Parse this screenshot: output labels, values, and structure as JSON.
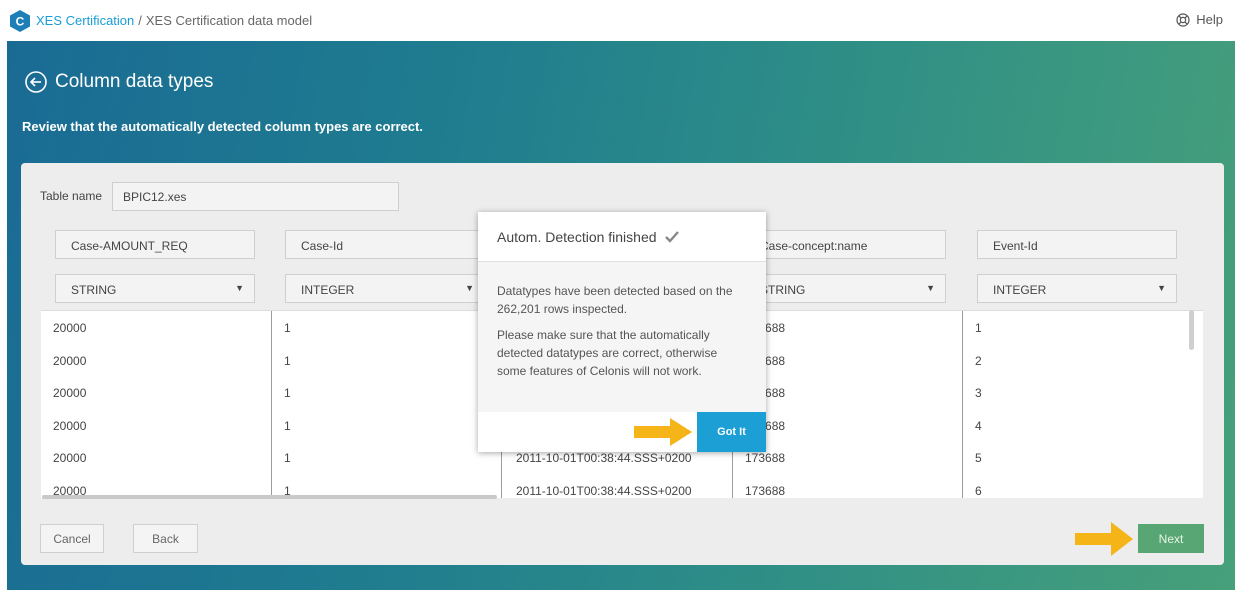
{
  "header": {
    "logo_letter": "C",
    "breadcrumb_link": "XES Certification",
    "breadcrumb_separator": "/",
    "breadcrumb_current": "XES Certification data model",
    "help_label": "Help"
  },
  "page": {
    "title": "Column data types",
    "subtitle": "Review that the automatically detected column types are correct."
  },
  "table": {
    "name_label": "Table name",
    "name_value": "BPIC12.xes"
  },
  "columns": [
    {
      "name": "Case-AMOUNT_REQ",
      "type": "STRING",
      "values": [
        "20000",
        "20000",
        "20000",
        "20000",
        "20000",
        "20000"
      ]
    },
    {
      "name": "Case-Id",
      "type": "INTEGER",
      "values": [
        "1",
        "1",
        "1",
        "1",
        "1",
        "1"
      ]
    },
    {
      "name": "",
      "type": "",
      "values": [
        "",
        "",
        "",
        "",
        "2011-10-01T00:38:44.SSS+0200",
        "2011-10-01T00:38:44.SSS+0200"
      ]
    },
    {
      "name": "Case-concept:name",
      "type": "STRING",
      "values": [
        "173688",
        "173688",
        "173688",
        "173688",
        "173688",
        "173688"
      ]
    },
    {
      "name": "Event-Id",
      "type": "INTEGER",
      "values": [
        "1",
        "2",
        "3",
        "4",
        "5",
        "6"
      ]
    }
  ],
  "buttons": {
    "cancel": "Cancel",
    "back": "Back",
    "next": "Next"
  },
  "dialog": {
    "title": "Autom. Detection finished",
    "message1": "Datatypes have been detected based on the 262,201 rows inspected.",
    "message2": "Please make sure that the automatically detected datatypes are correct, otherwise some features of Celonis will not work.",
    "confirm": "Got It"
  },
  "colors": {
    "accent": "#1b9fd4",
    "next_button": "#57a673",
    "arrow": "#f5b417"
  }
}
